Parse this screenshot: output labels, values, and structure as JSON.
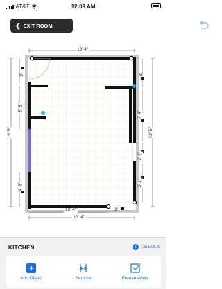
{
  "status_bar": {
    "carrier": "AT&T",
    "time": "12:09 AM"
  },
  "header": {
    "exit_label": "EXIT ROOM",
    "back_icon": "chevron-left-icon",
    "undo_icon": "undo-icon"
  },
  "floor_plan": {
    "top_dimension": "13' 4\"",
    "bottom_dimension": "13' 4\"",
    "bottom_inner_dimension": "10' 4\"",
    "bottom_small_dimension": "3'",
    "left_total_dimension": "19' 5\"",
    "right_total_dimension": "19' 5\"",
    "left_top_dimension": "3'",
    "left_upper_dimension": "5' 8\"",
    "left_lower_dimension": "4' 6\"",
    "right_top_dimension": "4'",
    "right_upper_dimension": "7' 4\"",
    "right_middle_dimension": "2' 9\"",
    "right_lower_dimension": "5' 1\"",
    "accent_color": "#1c6fd6",
    "wall_color": "#111111",
    "window_color": "#6b72d8"
  },
  "panel": {
    "room_name": "KITCHEN",
    "details_label": "DETAILS",
    "actions": [
      {
        "label": "Add Object",
        "icon": "plus-icon"
      },
      {
        "label": "Set size",
        "icon": "resize-icon"
      },
      {
        "label": "Freeze Walls",
        "icon": "freeze-walls-icon"
      }
    ]
  }
}
